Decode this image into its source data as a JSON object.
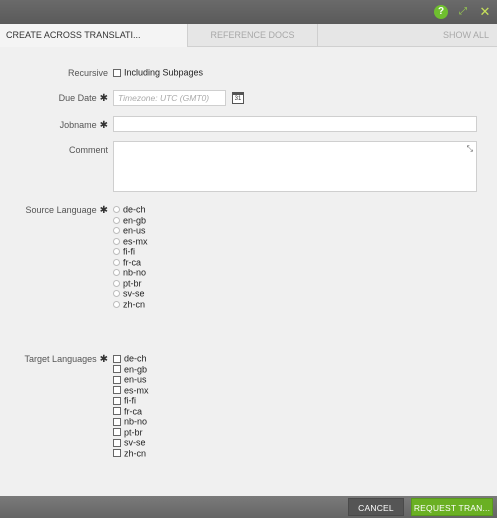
{
  "tabs": [
    {
      "label": "CREATE ACROSS TRANSLATI..."
    },
    {
      "label": "REFERENCE DOCS"
    },
    {
      "label": "SHOW ALL"
    }
  ],
  "form": {
    "recursive_label": "Recursive",
    "including_subpages": "Including Subpages",
    "due_date_label": "Due Date",
    "due_date_placeholder": "Timezone: UTC (GMT0)",
    "calendar_day": "31",
    "jobname_label": "Jobname",
    "comment_label": "Comment",
    "source_language_label": "Source Language",
    "target_languages_label": "Target Languages",
    "required_mark": "✱"
  },
  "source_languages": [
    "de-ch",
    "en-gb",
    "en-us",
    "es-mx",
    "fi-fi",
    "fr-ca",
    "nb-no",
    "pt-br",
    "sv-se",
    "zh-cn"
  ],
  "target_languages": [
    "de-ch",
    "en-gb",
    "en-us",
    "es-mx",
    "fi-fi",
    "fr-ca",
    "nb-no",
    "pt-br",
    "sv-se",
    "zh-cn"
  ],
  "buttons": {
    "cancel": "CANCEL",
    "request": "REQUEST TRAN..."
  },
  "icons": {
    "help": "question-circle-icon",
    "expand": "expand-icon",
    "close": "close-icon",
    "calendar": "calendar-icon",
    "resize": "resize-icon"
  },
  "colors": {
    "accent": "#6ab023",
    "titlebar": "#5f5f5f",
    "help_icon": "#6fbf2f"
  }
}
